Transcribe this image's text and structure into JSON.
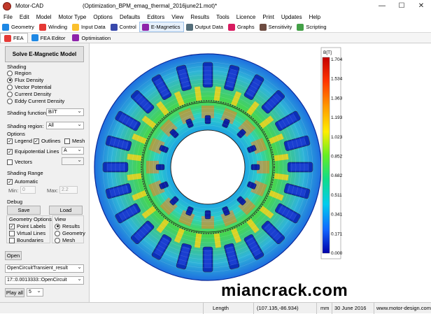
{
  "window": {
    "app_name": "Motor-CAD",
    "document_title": "(Optimization_BPM_emag_thermal_2016june21.mot)*",
    "minimize": "—",
    "maximize": "☐",
    "close": "✕"
  },
  "menu": [
    "File",
    "Edit",
    "Model",
    "Motor Type",
    "Options",
    "Defaults",
    "Editors",
    "View",
    "Results",
    "Tools",
    "Licence",
    "Print",
    "Updates",
    "Help"
  ],
  "toolbar": [
    {
      "label": "Geometry",
      "icon": "geometry-icon",
      "color": "#1e88e5"
    },
    {
      "label": "Winding",
      "icon": "winding-icon",
      "color": "#e53935"
    },
    {
      "label": "Input Data",
      "icon": "input-data-icon",
      "color": "#fbc02d"
    },
    {
      "label": "Control",
      "icon": "control-icon",
      "color": "#3949ab"
    },
    {
      "label": "E-Magnetics",
      "icon": "emagnetics-icon",
      "color": "#8e24aa"
    },
    {
      "label": "Output Data",
      "icon": "output-data-icon",
      "color": "#546e7a"
    },
    {
      "label": "Graphs",
      "icon": "graphs-icon",
      "color": "#d81b60"
    },
    {
      "label": "Sensitivity",
      "icon": "sensitivity-icon",
      "color": "#6d4c41"
    },
    {
      "label": "Scripting",
      "icon": "scripting-icon",
      "color": "#43a047"
    }
  ],
  "subtabs": [
    {
      "label": "FEA",
      "icon": "fea-icon"
    },
    {
      "label": "FEA Editor",
      "icon": "fea-editor-icon"
    },
    {
      "label": "Optimisation",
      "icon": "optimisation-icon"
    }
  ],
  "panel": {
    "solve_label": "Solve E-Magnetic Model",
    "shading_title": "Shading",
    "shading_options": [
      "Region",
      "Flux Density",
      "Vector Potential",
      "Current Density",
      "Eddy Current Density"
    ],
    "shading_selected": "Flux Density",
    "shading_function_label": "Shading function:",
    "shading_function_value": "B//T",
    "shading_region_label": "Shading region:",
    "shading_region_value": "All",
    "options_title": "Options",
    "legend_label": "Legend",
    "outlines_label": "Outlines",
    "mesh_label": "Mesh",
    "equipotential_label": "Equipotential Lines",
    "equipotential_value": "A",
    "vectors_label": "Vectors",
    "shading_range_title": "Shading Range",
    "automatic_label": "Automatic",
    "min_label": "Min:",
    "min_value": "0",
    "max_label": "Max:",
    "max_value": "2.2",
    "debug_title": "Debug",
    "save_label": "Save",
    "load_label": "Load",
    "geometry_options_title": "Geometry Options",
    "point_labels": "Point Labels",
    "virtual_lines": "Virtual Lines",
    "boundaries": "Boundaries",
    "view_title": "View",
    "view_options": [
      "Results",
      "Geometry",
      "Mesh"
    ],
    "view_selected": "Results",
    "open_label": "Open",
    "result_dropdown": "OpenCircuitTransient_result",
    "step_dropdown": "17::0.0013333::OpenCircuit",
    "play_label": "Play all",
    "play_speed": "5"
  },
  "legend": {
    "unit": "B[T]",
    "ticks": [
      "1.704",
      "1.534",
      "1.363",
      "1.193",
      "1.023",
      "0.852",
      "0.682",
      "0.511",
      "0.341",
      "0.171",
      "0.000"
    ]
  },
  "status": {
    "field": "Length",
    "coords": "(107.135,-86.934)",
    "unit": "mm",
    "date": "30 June 2016",
    "website": "www.motor-design.com"
  },
  "watermark": "miancrack.com"
}
